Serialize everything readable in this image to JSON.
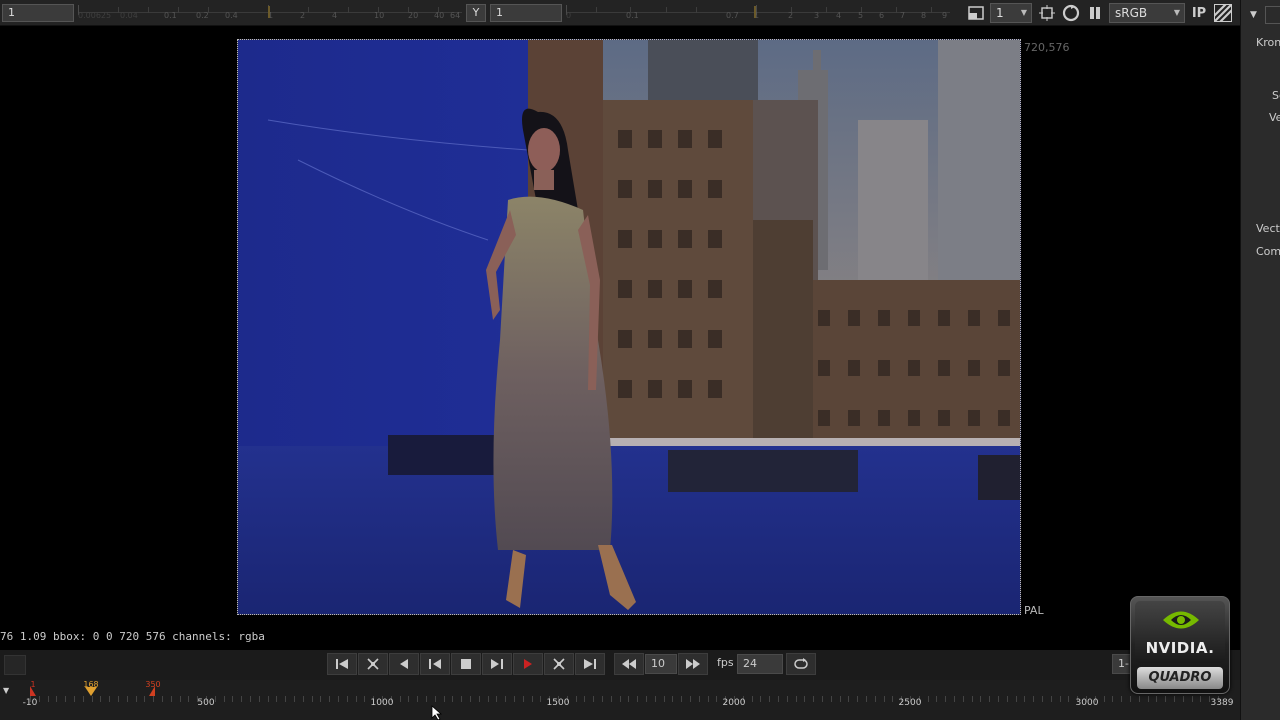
{
  "toolbar": {
    "channel_value": "1",
    "y_label": "Y",
    "y_value": "1",
    "gain_scale": [
      "0.00625",
      "0.04",
      "0.1",
      "0.2",
      "0.4",
      "1",
      "2",
      "4",
      "10",
      "20",
      "40",
      "64"
    ],
    "gamma_scale": [
      "0",
      "0.1",
      "0.7",
      "1",
      "2",
      "3",
      "4",
      "5",
      "6",
      "7",
      "8",
      "9"
    ],
    "input_process_value": "1",
    "colorspace": "sRGB",
    "ip_label": "IP"
  },
  "viewer": {
    "image_corner": "720,576",
    "format": "PAL"
  },
  "status": {
    "info_line": "76 1.09 bbox: 0 0 720 576 channels: rgba"
  },
  "playback": {
    "frame_increment": "10",
    "fps_label": "fps",
    "fps_value": "24",
    "range_label": "1-"
  },
  "timeline": {
    "ticks": [
      "-10",
      "500",
      "1000",
      "1500",
      "2000",
      "2500",
      "3000",
      "3389"
    ],
    "current_frame": "168",
    "out_marker": "350",
    "in_marker": "1"
  },
  "properties_panel": {
    "labels": [
      "Kron",
      "Sc",
      "Ve",
      "Vect",
      "Com"
    ]
  },
  "badge": {
    "brand": "NVIDIA.",
    "product": "QUADRO"
  },
  "colors": {
    "toolbar_bg": "#232323",
    "panel_bg": "#2b2b2b",
    "current_frame_marker": "#e0a030",
    "out_marker": "#d04020",
    "in_marker": "#cc3322",
    "nvidia_green": "#76b900"
  }
}
